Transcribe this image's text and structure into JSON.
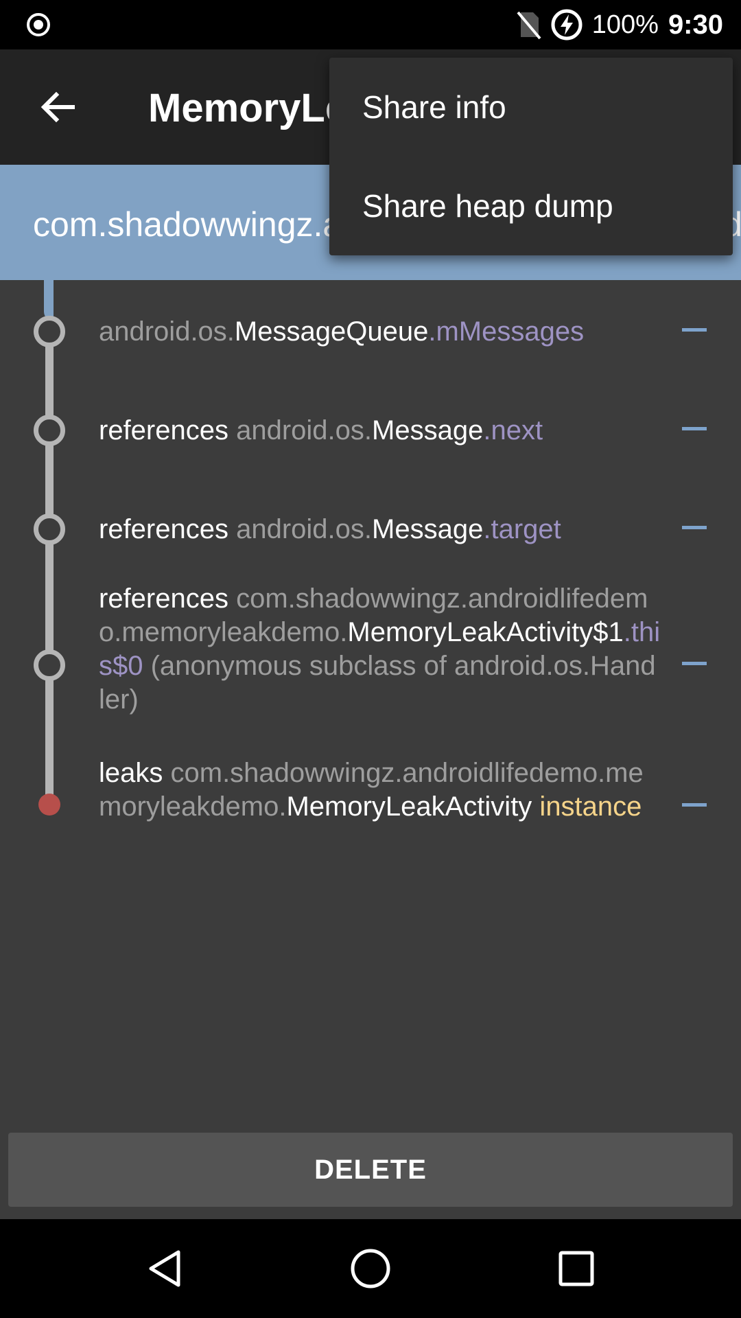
{
  "status_bar": {
    "battery": "100%",
    "time": "9:30",
    "icons": [
      "record-icon",
      "no-sim-icon",
      "battery-charging-icon"
    ]
  },
  "toolbar": {
    "title": "MemoryLeakActivity",
    "back_icon": "arrow-back-icon"
  },
  "header": {
    "text": "com.shadowwingz.androidlifedemo has leaked:"
  },
  "menu": {
    "items": [
      {
        "label": "Share info"
      },
      {
        "label": "Share heap dump"
      }
    ]
  },
  "trace": {
    "rows": [
      {
        "prefix": "",
        "package": "android.os.",
        "class": "MessageQueue",
        "field": ".mMessages",
        "suffix": ""
      },
      {
        "prefix": "references ",
        "package": "android.os.",
        "class": "Message",
        "field": ".next",
        "suffix": ""
      },
      {
        "prefix": "references ",
        "package": "android.os.",
        "class": "Message",
        "field": ".target",
        "suffix": ""
      },
      {
        "prefix": "references ",
        "package": "com.shadowwingz.androidlifedemo.memoryleakdemo.",
        "class": "MemoryLeakActivity$1",
        "field": ".this$0",
        "suffix": " (anonymous subclass of android.os.Handler)"
      },
      {
        "prefix": "leaks ",
        "package": "com.shadowwingz.androidlifedemo.memoryleakdemo.",
        "class": "MemoryLeakActivity",
        "field": "",
        "suffix": " instance"
      }
    ]
  },
  "actions": {
    "delete_label": "DELETE"
  },
  "colors": {
    "header_band": "#81a2c4",
    "background": "#3c3c3c",
    "field": "#9e93c4",
    "instance": "#f6d48a",
    "leak_dot": "#b74f4b"
  }
}
